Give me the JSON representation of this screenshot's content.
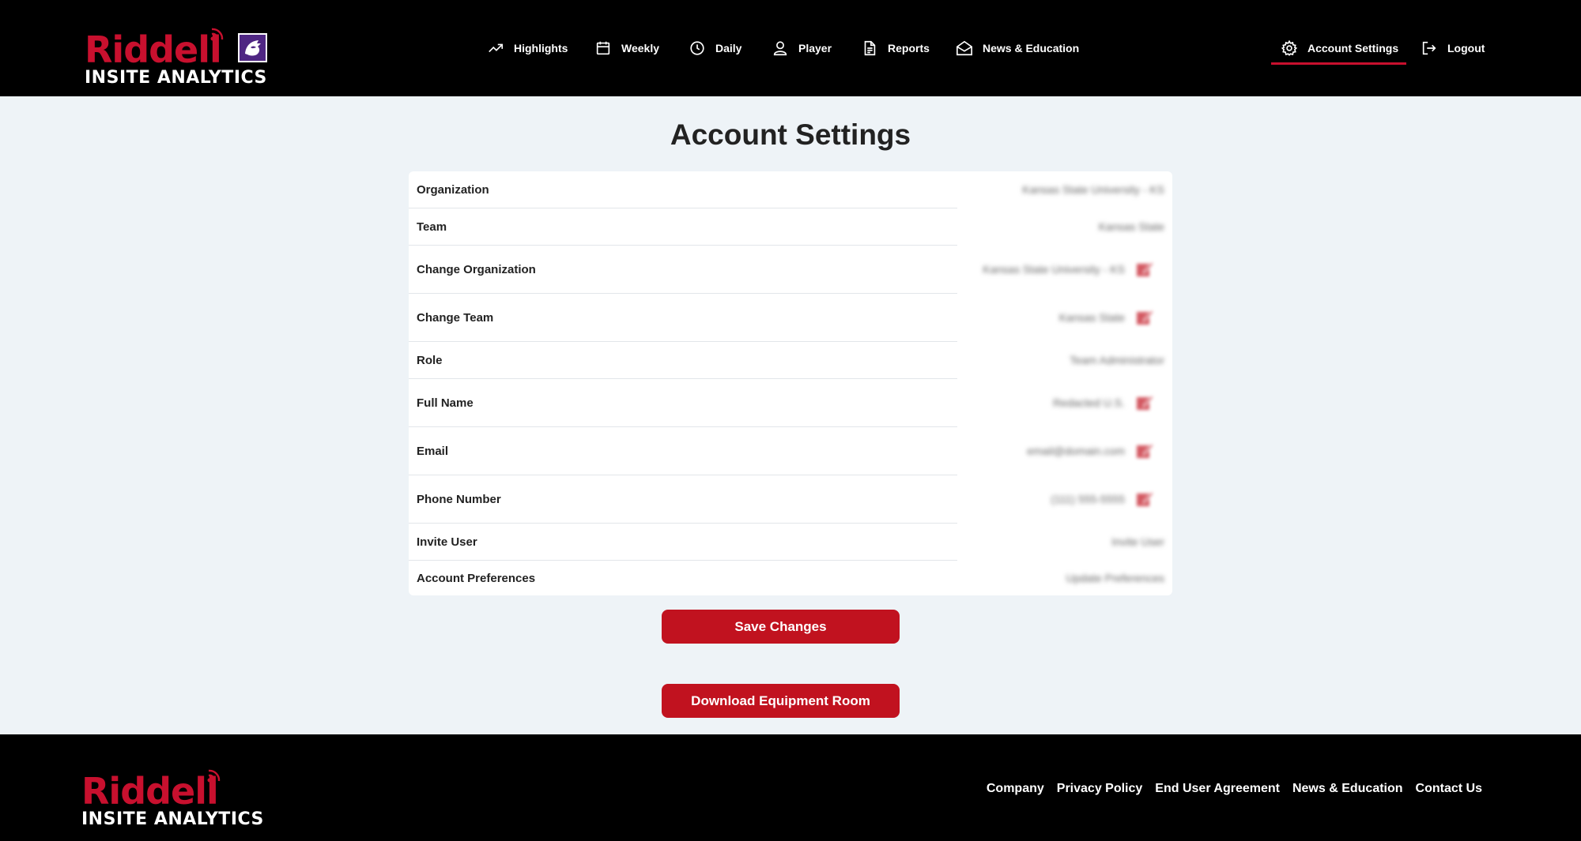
{
  "brand": {
    "name": "Riddell",
    "tagline": "INSITE ANALYTICS"
  },
  "nav": {
    "items": [
      {
        "label": "Highlights",
        "icon": "trend-up-icon"
      },
      {
        "label": "Weekly",
        "icon": "calendar-icon"
      },
      {
        "label": "Daily",
        "icon": "clock-icon"
      },
      {
        "label": "Player",
        "icon": "user-icon"
      },
      {
        "label": "Reports",
        "icon": "document-icon"
      },
      {
        "label": "News & Education",
        "icon": "mail-open-icon"
      }
    ],
    "account_settings": "Account Settings",
    "logout": "Logout"
  },
  "page": {
    "title": "Account Settings"
  },
  "settings": {
    "rows": [
      {
        "label": "Organization",
        "value": "Kansas State University - KS"
      },
      {
        "label": "Team",
        "value": "Kansas State"
      },
      {
        "label": "Change Organization",
        "value": "Kansas State University - KS"
      },
      {
        "label": "Change Team",
        "value": "Kansas State"
      },
      {
        "label": "Role",
        "value": "Team Administrator"
      },
      {
        "label": "Full Name",
        "value": "Redacted U.S."
      },
      {
        "label": "Email",
        "value": "email@domain.com"
      },
      {
        "label": "Phone Number",
        "value": "(111) 555-5555"
      },
      {
        "label": "Invite User",
        "value": "Invite User"
      },
      {
        "label": "Account Preferences",
        "value": "Update Preferences"
      }
    ]
  },
  "buttons": {
    "save": "Save Changes",
    "download": "Download Equipment Room"
  },
  "footer": {
    "links": [
      "Company",
      "Privacy Policy",
      "End User Agreement",
      "News & Education",
      "Contact Us"
    ]
  },
  "colors": {
    "accent": "#c1121f",
    "header_bg": "#000000",
    "page_bg": "#eef3f7",
    "team_purple": "#4f2683"
  }
}
